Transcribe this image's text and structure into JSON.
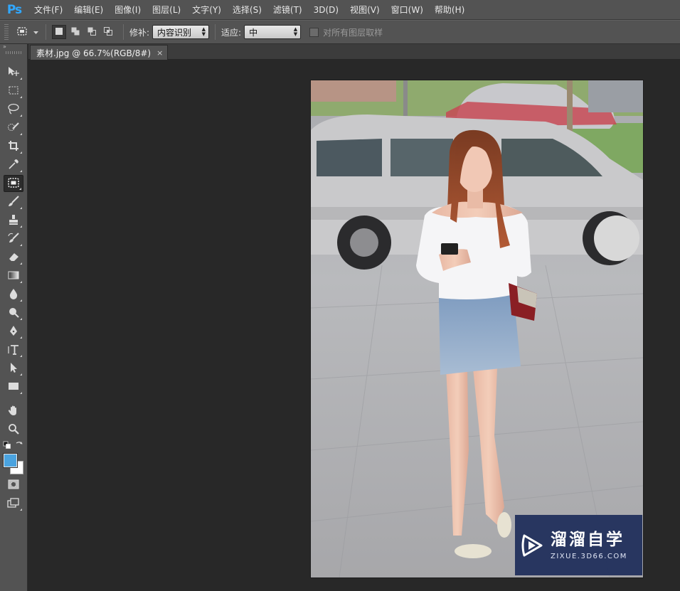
{
  "app": {
    "logo": "Ps",
    "accent_color": "#31a8ff"
  },
  "menu": {
    "items": [
      {
        "label": "文件(F)"
      },
      {
        "label": "编辑(E)"
      },
      {
        "label": "图像(I)"
      },
      {
        "label": "图层(L)"
      },
      {
        "label": "文字(Y)"
      },
      {
        "label": "选择(S)"
      },
      {
        "label": "滤镜(T)"
      },
      {
        "label": "3D(D)"
      },
      {
        "label": "视图(V)"
      },
      {
        "label": "窗口(W)"
      },
      {
        "label": "帮助(H)"
      }
    ]
  },
  "options_bar": {
    "tool_preset_icon": "patch-tool-icon",
    "modes": [
      {
        "name": "new-selection-icon",
        "active": true
      },
      {
        "name": "add-to-selection-icon",
        "active": false
      },
      {
        "name": "subtract-from-selection-icon",
        "active": false
      },
      {
        "name": "intersect-selection-icon",
        "active": false
      }
    ],
    "patch_label": "修补:",
    "patch_value": "内容识别",
    "adapt_label": "适应:",
    "adapt_value": "中",
    "sample_all_label": "对所有图层取样",
    "sample_all_checked": false
  },
  "toolbar": {
    "collapse_glyph": "»",
    "tools": [
      {
        "name": "move-tool-icon"
      },
      {
        "name": "marquee-tool-icon"
      },
      {
        "name": "lasso-tool-icon"
      },
      {
        "name": "quick-selection-tool-icon"
      },
      {
        "name": "crop-tool-icon"
      },
      {
        "name": "eyedropper-tool-icon"
      },
      {
        "name": "patch-tool-icon",
        "active": true
      },
      {
        "name": "brush-tool-icon"
      },
      {
        "name": "clone-stamp-tool-icon"
      },
      {
        "name": "history-brush-tool-icon"
      },
      {
        "name": "eraser-tool-icon"
      },
      {
        "name": "gradient-tool-icon"
      },
      {
        "name": "blur-tool-icon"
      },
      {
        "name": "dodge-tool-icon"
      },
      {
        "name": "pen-tool-icon"
      },
      {
        "name": "type-tool-icon"
      },
      {
        "name": "path-selection-tool-icon"
      },
      {
        "name": "rectangle-tool-icon"
      },
      {
        "name": "hand-tool-icon"
      },
      {
        "name": "zoom-tool-icon"
      }
    ],
    "foreground_color": "#4aa3df",
    "background_color": "#ffffff"
  },
  "document": {
    "tab_title": "素材.jpg @ 66.7%(RGB/8#)",
    "close_glyph": "×"
  },
  "watermark": {
    "title": "溜溜自学",
    "subtitle": "ZIXUE.3D66.COM",
    "bg_color": "#1e2d5a"
  }
}
